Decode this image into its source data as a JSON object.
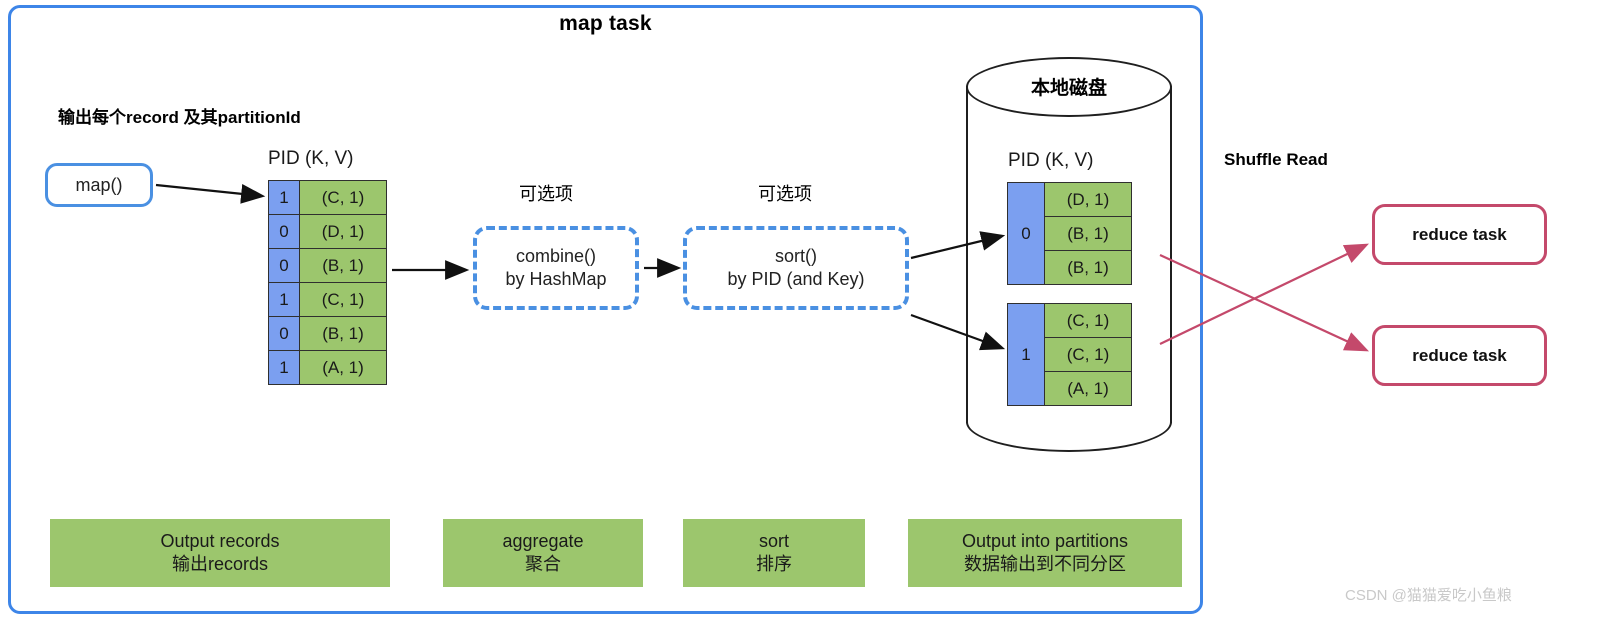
{
  "diagram": {
    "title": "map task",
    "watermark": "CSDN @猫猫爱吃小鱼粮",
    "colors": {
      "frame_blue": "#3d85e8",
      "record_green": "#9cc66d",
      "pid_blue": "#7b9ff0",
      "reduce_crimson": "#c4496b",
      "dashed_blue": "#4a90e2"
    }
  },
  "left_stage": {
    "heading": "输出每个record 及其partitionId",
    "map_node_label": "map()",
    "table_caption": "PID  (K, V)",
    "rows": [
      {
        "pid": "1",
        "kv": "(C, 1)"
      },
      {
        "pid": "0",
        "kv": "(D, 1)"
      },
      {
        "pid": "0",
        "kv": "(B, 1)"
      },
      {
        "pid": "1",
        "kv": "(C, 1)"
      },
      {
        "pid": "0",
        "kv": "(B, 1)"
      },
      {
        "pid": "1",
        "kv": "(A, 1)"
      }
    ]
  },
  "combine_stage": {
    "optional_label": "可选项",
    "line1": "combine()",
    "line2": "by HashMap"
  },
  "sort_stage": {
    "optional_label": "可选项",
    "line1": "sort()",
    "line2": "by PID (and Key)"
  },
  "disk_stage": {
    "disk_title": "本地磁盘",
    "table_caption": "PID  (K, V)",
    "partitions": [
      {
        "pid": "0",
        "records": [
          "(D, 1)",
          "(B, 1)",
          "(B, 1)"
        ]
      },
      {
        "pid": "1",
        "records": [
          "(C, 1)",
          "(C, 1)",
          "(A, 1)"
        ]
      }
    ]
  },
  "shuffle": {
    "label": "Shuffle Read",
    "reduce_tasks": [
      {
        "label": "reduce task"
      },
      {
        "label": "reduce task"
      }
    ]
  },
  "legend_bars": [
    {
      "en": "Output records",
      "zh": "输出records"
    },
    {
      "en": "aggregate",
      "zh": "聚合"
    },
    {
      "en": "sort",
      "zh": "排序"
    },
    {
      "en": "Output into partitions",
      "zh": "数据输出到不同分区"
    }
  ]
}
